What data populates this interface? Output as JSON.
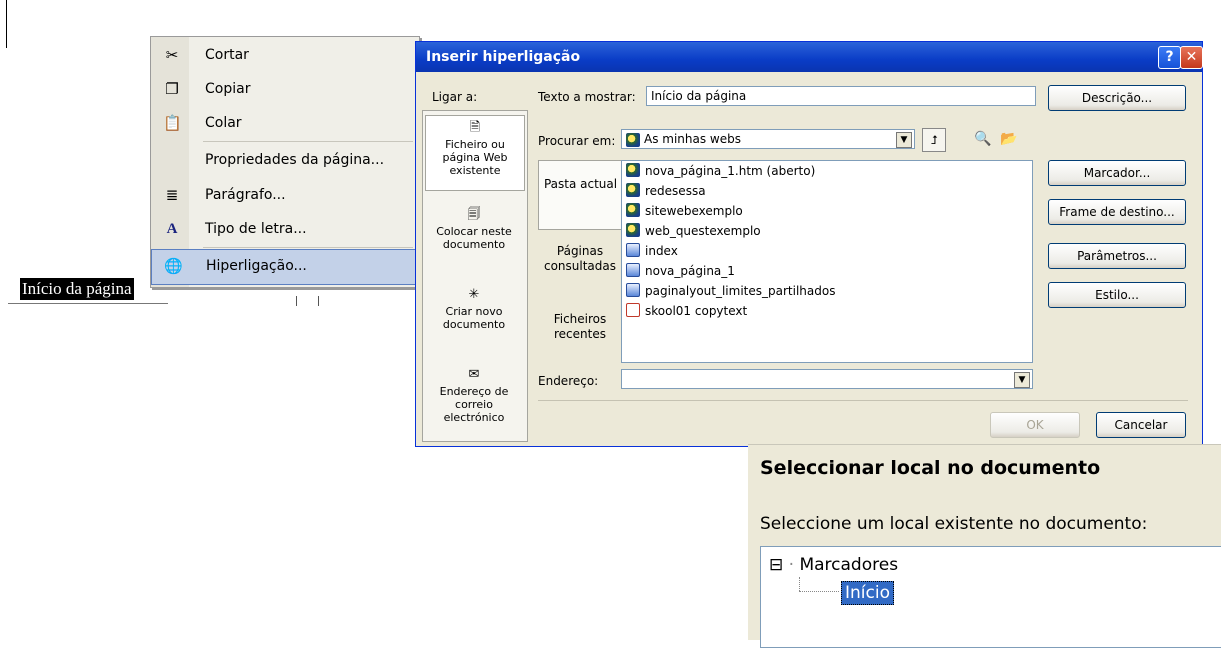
{
  "document": {
    "selected_text": "Início da página"
  },
  "context_menu": {
    "items": [
      {
        "label": "Cortar",
        "icon": "scissors-icon"
      },
      {
        "label": "Copiar",
        "icon": "copy-icon"
      },
      {
        "label": "Colar",
        "icon": "paste-icon"
      },
      {
        "label": "Propriedades da página...",
        "icon": ""
      },
      {
        "label": "Parágrafo...",
        "icon": "paragraph-icon"
      },
      {
        "label": "Tipo de letra...",
        "icon": "font-icon"
      },
      {
        "label": "Hiperligação...",
        "icon": "hyperlink-globe-icon",
        "highlighted": true
      }
    ]
  },
  "hyperlink_dialog": {
    "title": "Inserir hiperligação",
    "help_glyph": "?",
    "close_glyph": "✕",
    "link_to_label": "Ligar a:",
    "text_to_display_label": "Texto a mostrar:",
    "text_to_display_value": "Início da página",
    "description_button": "Descrição...",
    "look_in_label": "Procurar em:",
    "look_in_value": "As minhas webs",
    "nav": [
      {
        "label": "Ficheiro ou página Web existente",
        "icon": "existing-file-icon",
        "active": true
      },
      {
        "label": "Colocar neste documento",
        "icon": "place-in-document-icon"
      },
      {
        "label": "Criar novo documento",
        "icon": "new-document-icon"
      },
      {
        "label": "Endereço de correio electrónico",
        "icon": "email-icon"
      }
    ],
    "tabs": [
      {
        "label": "Pasta actual",
        "active": true
      },
      {
        "label": "Páginas consultadas"
      },
      {
        "label": "Ficheiros recentes"
      }
    ],
    "files": [
      {
        "name": "nova_página_1.htm (aberto)",
        "icon": "web-page-icon"
      },
      {
        "name": "redesessa",
        "icon": "web-folder-icon"
      },
      {
        "name": "sitewebexemplo",
        "icon": "web-folder-icon"
      },
      {
        "name": "web_questexemplo",
        "icon": "web-folder-icon"
      },
      {
        "name": "index",
        "icon": "page-icon"
      },
      {
        "name": "nova_página_1",
        "icon": "page-icon"
      },
      {
        "name": "paginalyout_limites_partilhados",
        "icon": "page-icon"
      },
      {
        "name": "skool01 copytext",
        "icon": "text-file-icon"
      }
    ],
    "address_label": "Endereço:",
    "address_value": "",
    "side_buttons": {
      "bookmark": "Marcador...",
      "target_frame": "Frame de destino...",
      "parameters": "Parâmetros...",
      "style": "Estilo..."
    },
    "ok_button": "OK",
    "cancel_button": "Cancelar"
  },
  "location_dialog": {
    "title": "Seleccionar local no documento",
    "prompt": "Seleccione um local existente no documento:",
    "tree": {
      "root": "Marcadores",
      "root_toggle": "⊟",
      "children": [
        "Início"
      ]
    }
  }
}
